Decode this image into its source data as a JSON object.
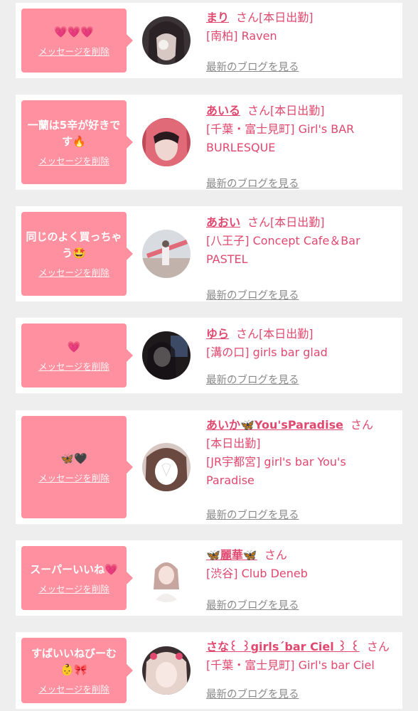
{
  "common": {
    "delete_label": "メッセージを削除",
    "blog_label": "最新のブログを見る",
    "san": "さん"
  },
  "cards": [
    {
      "message": "💗💗💗",
      "name": "まり",
      "status": "[本日出勤]",
      "shop": "[南柏] Raven"
    },
    {
      "message": "一蘭は5辛が好きです🔥",
      "name": "あいる",
      "status": "[本日出勤]",
      "shop": "[千葉・富士見町] Girl's BAR BURLESQUE"
    },
    {
      "message": "同じのよく買っちゃう🤩",
      "name": "あおい",
      "status": "[本日出勤]",
      "shop": "[八王子] Concept Cafe＆Bar PASTEL"
    },
    {
      "message": "💗",
      "name": "ゆら",
      "status": "[本日出勤]",
      "shop": "[溝の口] girls bar glad"
    },
    {
      "message": "🦋🖤",
      "name": "あいか🦋You'sParadise",
      "status": "[本日出勤]",
      "shop": "[JR宇都宮] girl's bar You's Paradise"
    },
    {
      "message": "スーパーいいね💗",
      "name": "🦋麗華🦋",
      "status": "",
      "shop": "[渋谷] Club Deneb"
    },
    {
      "message": "すばいいねびーむ👶🎀",
      "name": "さな꒰ ꒱girls´bar Ciel ꒱ ꒰",
      "status": "",
      "shop": "[千葉・富士見町] Girl's bar Ciel"
    }
  ],
  "colors": {
    "accent": "#e0486f",
    "bubble": "#ff909f",
    "background": "#eeeeee",
    "link_gray": "#8a8a8a"
  }
}
